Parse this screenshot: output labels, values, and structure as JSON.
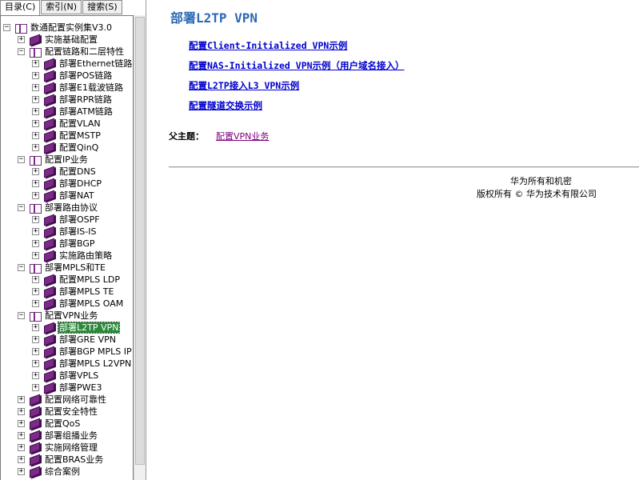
{
  "tabs": [
    {
      "label": "目录(C)",
      "active": true
    },
    {
      "label": "索引(N)",
      "active": false
    },
    {
      "label": "搜索(S)",
      "active": false
    }
  ],
  "tree": [
    {
      "level": 0,
      "exp": "−",
      "icon": "open",
      "label": "数通配置实例集V3.0"
    },
    {
      "level": 1,
      "exp": "+",
      "icon": "closed",
      "label": "实施基础配置"
    },
    {
      "level": 1,
      "exp": "−",
      "icon": "open",
      "label": "配置链路和二层特性"
    },
    {
      "level": 2,
      "exp": "+",
      "icon": "closed",
      "label": "部署Ethernet链路"
    },
    {
      "level": 2,
      "exp": "+",
      "icon": "closed",
      "label": "部署POS链路"
    },
    {
      "level": 2,
      "exp": "+",
      "icon": "closed",
      "label": "部署E1载波链路"
    },
    {
      "level": 2,
      "exp": "+",
      "icon": "closed",
      "label": "部署RPR链路"
    },
    {
      "level": 2,
      "exp": "+",
      "icon": "closed",
      "label": "部署ATM链路"
    },
    {
      "level": 2,
      "exp": "+",
      "icon": "closed",
      "label": "配置VLAN"
    },
    {
      "level": 2,
      "exp": "+",
      "icon": "closed",
      "label": "配置MSTP"
    },
    {
      "level": 2,
      "exp": "+",
      "icon": "closed",
      "label": "配置QinQ"
    },
    {
      "level": 1,
      "exp": "−",
      "icon": "open",
      "label": "配置IP业务"
    },
    {
      "level": 2,
      "exp": "+",
      "icon": "closed",
      "label": "配置DNS"
    },
    {
      "level": 2,
      "exp": "+",
      "icon": "closed",
      "label": "部署DHCP"
    },
    {
      "level": 2,
      "exp": "+",
      "icon": "closed",
      "label": "部署NAT"
    },
    {
      "level": 1,
      "exp": "−",
      "icon": "open",
      "label": "部署路由协议"
    },
    {
      "level": 2,
      "exp": "+",
      "icon": "closed",
      "label": "部署OSPF"
    },
    {
      "level": 2,
      "exp": "+",
      "icon": "closed",
      "label": "部署IS-IS"
    },
    {
      "level": 2,
      "exp": "+",
      "icon": "closed",
      "label": "部署BGP"
    },
    {
      "level": 2,
      "exp": "+",
      "icon": "closed",
      "label": "实施路由策略"
    },
    {
      "level": 1,
      "exp": "−",
      "icon": "open",
      "label": "部署MPLS和TE"
    },
    {
      "level": 2,
      "exp": "+",
      "icon": "closed",
      "label": "配置MPLS LDP"
    },
    {
      "level": 2,
      "exp": "+",
      "icon": "closed",
      "label": "部署MPLS TE"
    },
    {
      "level": 2,
      "exp": "+",
      "icon": "closed",
      "label": "部署MPLS OAM"
    },
    {
      "level": 1,
      "exp": "−",
      "icon": "open",
      "label": "配置VPN业务"
    },
    {
      "level": 2,
      "exp": "+",
      "icon": "closed",
      "label": "部署L2TP VPN",
      "selected": true
    },
    {
      "level": 2,
      "exp": "+",
      "icon": "closed",
      "label": "部署GRE VPN"
    },
    {
      "level": 2,
      "exp": "+",
      "icon": "closed",
      "label": "部署BGP MPLS IP"
    },
    {
      "level": 2,
      "exp": "+",
      "icon": "closed",
      "label": "部署MPLS L2VPN"
    },
    {
      "level": 2,
      "exp": "+",
      "icon": "closed",
      "label": "部署VPLS"
    },
    {
      "level": 2,
      "exp": "+",
      "icon": "closed",
      "label": "部署PWE3"
    },
    {
      "level": 1,
      "exp": "+",
      "icon": "closed",
      "label": "配置网络可靠性"
    },
    {
      "level": 1,
      "exp": "+",
      "icon": "closed",
      "label": "配置安全特性"
    },
    {
      "level": 1,
      "exp": "+",
      "icon": "closed",
      "label": "配置QoS"
    },
    {
      "level": 1,
      "exp": "+",
      "icon": "closed",
      "label": "部署组播业务"
    },
    {
      "level": 1,
      "exp": "+",
      "icon": "closed",
      "label": "实施网络管理"
    },
    {
      "level": 1,
      "exp": "+",
      "icon": "closed",
      "label": "配置BRAS业务"
    },
    {
      "level": 1,
      "exp": "+",
      "icon": "closed",
      "label": "综合案例"
    }
  ],
  "page": {
    "title": "部署L2TP VPN",
    "links": [
      "配置Client-Initialized VPN示例",
      "配置NAS-Initialized VPN示例（用户域名接入）",
      "配置L2TP接入L3 VPN示例",
      "配置隧道交换示例"
    ],
    "parent_label": "父主题：",
    "parent_link": "配置VPN业务",
    "footer_line1": "华为所有和机密",
    "footer_line2": "版权所有 © 华为技术有限公司"
  },
  "colors": {
    "title": "#2a69b4",
    "link": "#0000cc",
    "visited_link": "#800080",
    "selected_bg": "#2a8a3a",
    "book": "#7b2a86"
  }
}
